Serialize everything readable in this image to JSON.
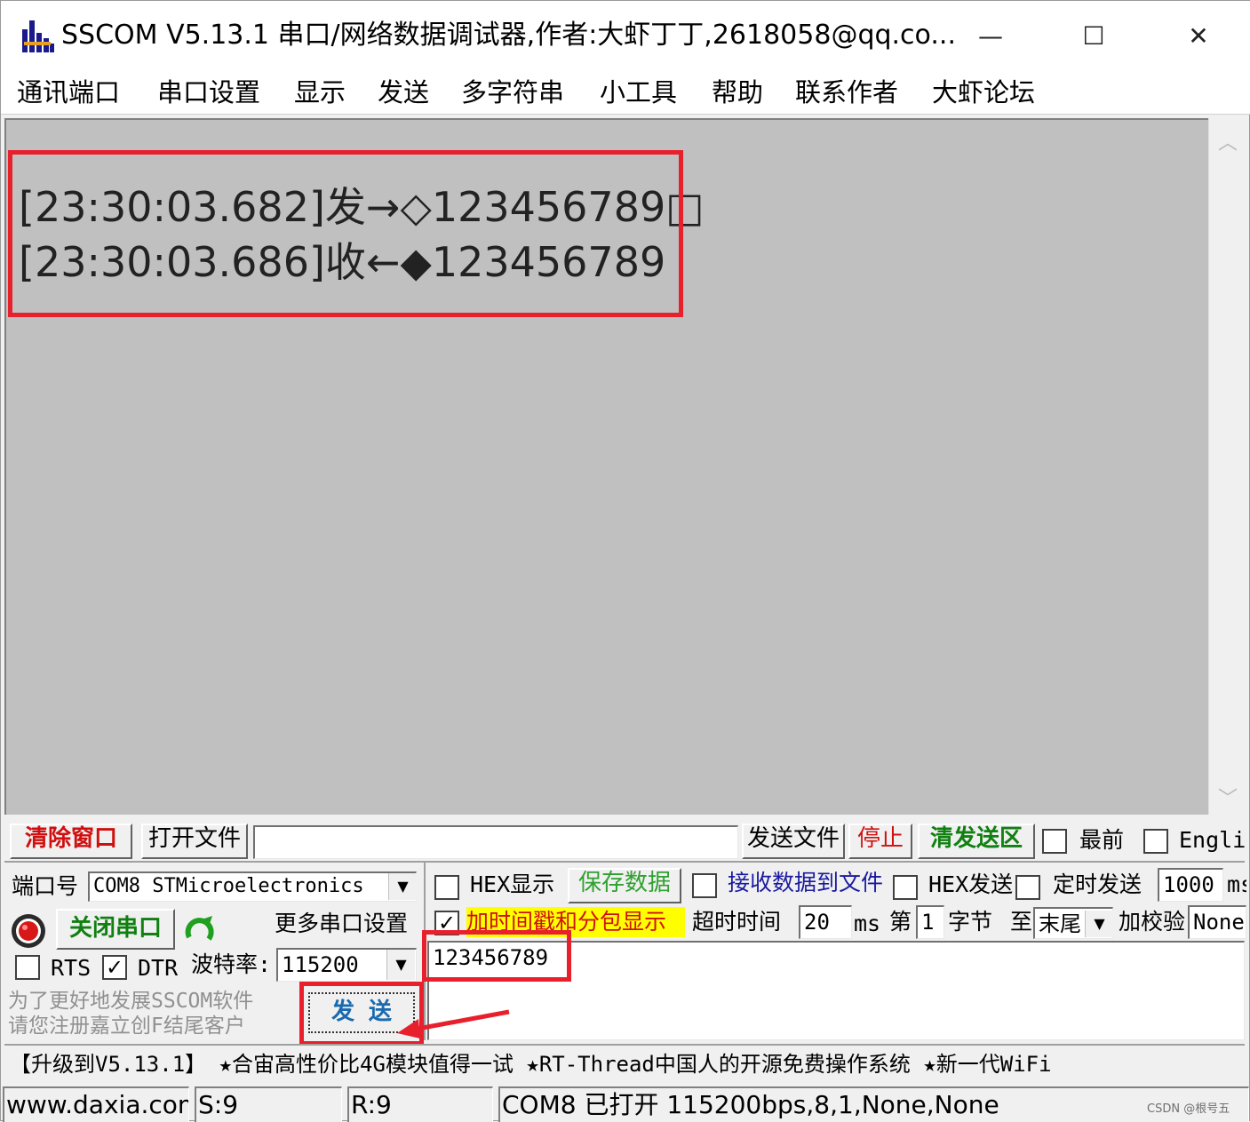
{
  "window": {
    "title": "SSCOM V5.13.1 串口/网络数据调试器,作者:大虾丁丁,2618058@qq.co...",
    "controls": {
      "minimize": "—",
      "maximize": "☐",
      "close": "✕"
    }
  },
  "menu": [
    "通讯端口",
    "串口设置",
    "显示",
    "发送",
    "多字符串",
    "小工具",
    "帮助",
    "联系作者",
    "大虾论坛"
  ],
  "receive": {
    "lines": [
      "[23:30:03.682]发→◇123456789□",
      "[23:30:03.686]收←◆123456789"
    ]
  },
  "toolbar": {
    "clear_window": "清除窗口",
    "open_file": "打开文件",
    "file_path": "",
    "send_file": "发送文件",
    "stop": "停止",
    "clear_send": "清发送区",
    "topmost": "最前",
    "english": "English"
  },
  "port": {
    "label": "端口号",
    "value": "COM8 STMicroelectronics",
    "close_port": "关闭串口",
    "more_settings": "更多串口设置",
    "rts": "RTS",
    "dtr": "DTR",
    "rts_checked": false,
    "dtr_checked": true,
    "baud_label": "波特率:",
    "baud_value": "115200"
  },
  "options": {
    "hex_display": "HEX显示",
    "save_data": "保存数据",
    "recv_to_file": "接收数据到文件",
    "hex_send": "HEX发送",
    "timed_send": "定时发送",
    "timed_value": "1000",
    "timed_unit": "ms",
    "timestamp": "加时间戳和分包显示",
    "timeout_label": "超时时间",
    "timeout_value": "20",
    "timeout_unit": "ms",
    "nth_label": "第",
    "nth_value": "1",
    "byte_label": "字节",
    "to_label": "至",
    "to_value": "末尾",
    "checksum_label": "加校验",
    "checksum_value": "None",
    "timestamp_checked": true
  },
  "send": {
    "text": "123456789",
    "button": "发  送",
    "promo": "为了更好地发展SSCOM软件\n请您注册嘉立创F结尾客户"
  },
  "ticker": "【升级到V5.13.1】 ★合宙高性价比4G模块值得一试  ★RT-Thread中国人的开源免费操作系统  ★新一代WiFi",
  "status": {
    "site": "www.daxia.com",
    "sent": "S:9",
    "received": "R:9",
    "port_state": "COM8 已打开  115200bps,8,1,None,None"
  },
  "watermark": "CSDN @根号五"
}
